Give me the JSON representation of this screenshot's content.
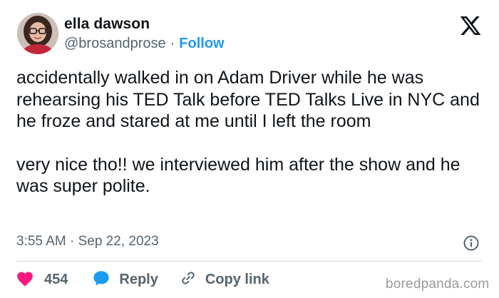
{
  "author": {
    "name": "ella dawson",
    "handle": "@brosandprose",
    "separator": "·",
    "follow_label": "Follow"
  },
  "platform_icon": "x-logo-icon",
  "tweet": {
    "paragraphs": [
      "accidentally walked in on Adam Driver while he was rehearsing his TED Talk before TED Talks Live in NYC and he froze and stared at me until I left the room",
      "very nice tho!! we interviewed him after the show and he was super polite."
    ],
    "timestamp": "3:55 AM · Sep 22, 2023"
  },
  "actions": {
    "like_count": "454",
    "reply_label": "Reply",
    "copy_link_label": "Copy link"
  },
  "icons": [
    "heart-icon",
    "reply-bubble-icon",
    "link-icon",
    "info-icon"
  ],
  "colors": {
    "like": "#f91880",
    "reply": "#1d9bf0",
    "follow": "#1d9bf0",
    "secondary_text": "#536471"
  },
  "watermark": "boredpanda.com"
}
